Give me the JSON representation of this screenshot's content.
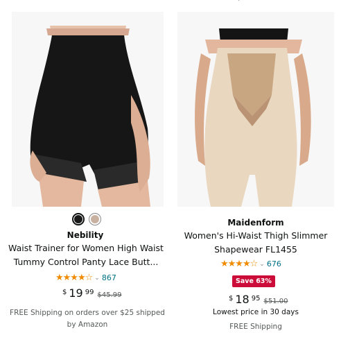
{
  "colors": {
    "accent_link": "#007185",
    "star": "#f08b00",
    "save_badge": "#cc0c39"
  },
  "top_mark": "›",
  "products": [
    {
      "brand": "Nebility",
      "title": "Waist Trainer for Women High Waist Tummy Control Panty Lace Butt...",
      "swatches": [
        {
          "color": "#1a1a1a",
          "selected": true
        },
        {
          "color": "#c9b1a1",
          "selected": false
        }
      ],
      "rating": 4.0,
      "stars_text": "★★★★☆",
      "rating_count": "867",
      "price": {
        "currency": "$",
        "whole": "19",
        "fraction": "99",
        "list_price": "$45.99"
      },
      "shipping": "FREE Shipping on orders over $25 shipped by Amazon"
    },
    {
      "brand": "Maidenform",
      "title": "Women's Hi-Waist Thigh Slimmer Shapewear FL1455",
      "rating": 4.0,
      "stars_text": "★★★★☆",
      "rating_count": "676",
      "badge": "Save 63%",
      "price": {
        "currency": "$",
        "whole": "18",
        "fraction": "95",
        "list_price": "$51.00"
      },
      "lowest_price_note": "Lowest price in 30 days",
      "shipping": "FREE Shipping"
    }
  ]
}
